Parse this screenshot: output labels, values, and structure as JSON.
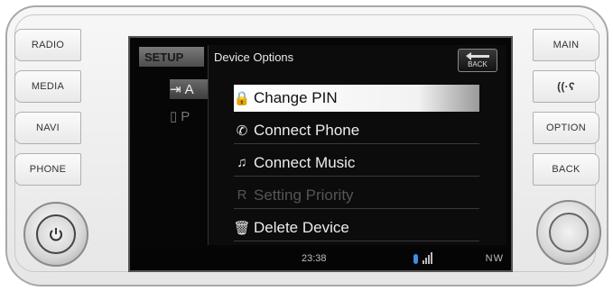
{
  "left_buttons": [
    "RADIO",
    "MEDIA",
    "NAVI",
    "PHONE"
  ],
  "right_buttons": {
    "main": "MAIN",
    "option": "OPTION",
    "back": "BACK"
  },
  "screen": {
    "tab": "SETUP",
    "background_items": [
      {
        "icon": "device-icon",
        "glyph": "⇥",
        "label": "A"
      },
      {
        "icon": "phone-icon",
        "glyph": "▯",
        "label": "P"
      }
    ],
    "popup": {
      "title": "Device Options",
      "back_label": "BACK",
      "items": [
        {
          "icon": "lock-icon",
          "glyph": "🔒",
          "label": "Change PIN",
          "state": "selected"
        },
        {
          "icon": "phone-handset-icon",
          "glyph": "✆",
          "label": "Connect Phone",
          "state": "normal"
        },
        {
          "icon": "music-note-icon",
          "glyph": "♫",
          "label": "Connect Music",
          "state": "normal"
        },
        {
          "icon": "priority-icon",
          "glyph": "R",
          "label": "Setting Priority",
          "state": "disabled"
        },
        {
          "icon": "trash-icon",
          "glyph": "🗑",
          "label": "Delete Device",
          "state": "normal"
        }
      ]
    },
    "status": {
      "time": "23:38",
      "direction": "NW"
    }
  },
  "colors": {
    "bluetooth": "#3f8fe0",
    "highlight": "#ffffff",
    "screen_bg": "#060606"
  }
}
